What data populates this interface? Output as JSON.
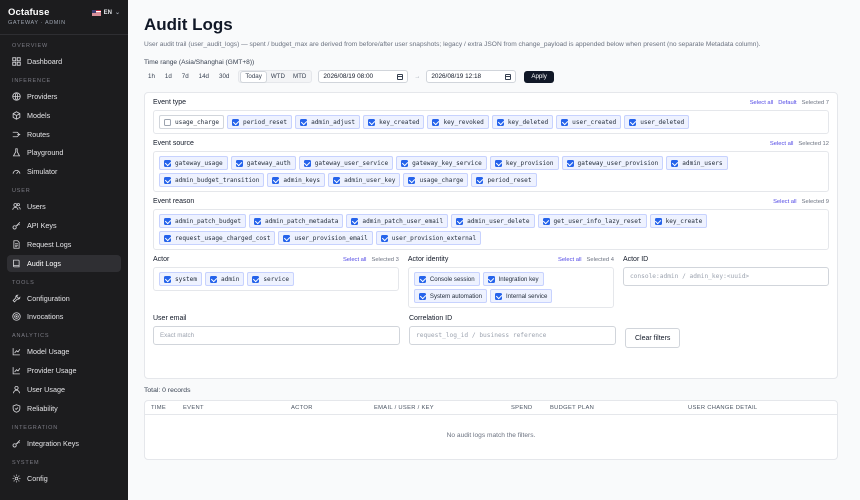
{
  "brand": {
    "name": "Octafuse",
    "subtitle": "GATEWAY · ADMIN",
    "lang": "EN"
  },
  "sidebar": {
    "sections": [
      {
        "label": "OVERVIEW",
        "items": [
          {
            "label": "Dashboard",
            "icon": "dashboard-icon"
          }
        ]
      },
      {
        "label": "INFERENCE",
        "items": [
          {
            "label": "Providers",
            "icon": "globe-icon"
          },
          {
            "label": "Models",
            "icon": "cube-icon"
          },
          {
            "label": "Routes",
            "icon": "routes-icon"
          },
          {
            "label": "Playground",
            "icon": "flask-icon"
          },
          {
            "label": "Simulator",
            "icon": "gauge-icon"
          }
        ]
      },
      {
        "label": "USER",
        "items": [
          {
            "label": "Users",
            "icon": "users-icon"
          },
          {
            "label": "API Keys",
            "icon": "key-icon"
          },
          {
            "label": "Request Logs",
            "icon": "file-icon"
          },
          {
            "label": "Audit Logs",
            "icon": "book-icon",
            "active": true
          }
        ]
      },
      {
        "label": "TOOLS",
        "items": [
          {
            "label": "Configuration",
            "icon": "wrench-icon"
          },
          {
            "label": "Invocations",
            "icon": "target-icon"
          }
        ]
      },
      {
        "label": "ANALYTICS",
        "items": [
          {
            "label": "Model Usage",
            "icon": "chart-icon"
          },
          {
            "label": "Provider Usage",
            "icon": "chart-icon"
          },
          {
            "label": "User Usage",
            "icon": "user-chart-icon"
          },
          {
            "label": "Reliability",
            "icon": "shield-icon"
          }
        ]
      },
      {
        "label": "INTEGRATION",
        "items": [
          {
            "label": "Integration Keys",
            "icon": "key-icon"
          }
        ]
      },
      {
        "label": "SYSTEM",
        "items": [
          {
            "label": "Config",
            "icon": "gear-icon"
          }
        ]
      }
    ]
  },
  "page": {
    "title": "Audit Logs",
    "subtitle": "User audit trail (user_audit_logs) — spent / budget_max are derived from before/after user snapshots; legacy / extra JSON from change_payload is appended below when present (no separate Metadata column)."
  },
  "time": {
    "label": "Time range (Asia/Shanghai (GMT+8))",
    "quick": [
      "1h",
      "1d",
      "7d",
      "14d",
      "30d"
    ],
    "periods": [
      "Today",
      "WTD",
      "MTD"
    ],
    "from": "2026/08/19 08:00",
    "to": "2026/08/19 12:18",
    "apply": "Apply"
  },
  "event_type": {
    "title": "Event type",
    "select_all": "Select all",
    "default": "Default",
    "selected": "Selected 7",
    "options": [
      {
        "label": "usage_charge",
        "checked": false
      },
      {
        "label": "period_reset",
        "checked": true
      },
      {
        "label": "admin_adjust",
        "checked": true
      },
      {
        "label": "key_created",
        "checked": true
      },
      {
        "label": "key_revoked",
        "checked": true
      },
      {
        "label": "key_deleted",
        "checked": true
      },
      {
        "label": "user_created",
        "checked": true
      },
      {
        "label": "user_deleted",
        "checked": true
      }
    ]
  },
  "event_source": {
    "title": "Event source",
    "select_all": "Select all",
    "selected": "Selected 12",
    "options": [
      {
        "label": "gateway_usage",
        "checked": true
      },
      {
        "label": "gateway_auth",
        "checked": true
      },
      {
        "label": "gateway_user_service",
        "checked": true
      },
      {
        "label": "gateway_key_service",
        "checked": true
      },
      {
        "label": "key_provision",
        "checked": true
      },
      {
        "label": "gateway_user_provision",
        "checked": true
      },
      {
        "label": "admin_users",
        "checked": true
      },
      {
        "label": "admin_budget_transition",
        "checked": true
      },
      {
        "label": "admin_keys",
        "checked": true
      },
      {
        "label": "admin_user_key",
        "checked": true
      },
      {
        "label": "usage_charge",
        "checked": true
      },
      {
        "label": "period_reset",
        "checked": true
      }
    ]
  },
  "event_reason": {
    "title": "Event reason",
    "select_all": "Select all",
    "selected": "Selected 9",
    "options": [
      {
        "label": "admin_patch_budget",
        "checked": true
      },
      {
        "label": "admin_patch_metadata",
        "checked": true
      },
      {
        "label": "admin_patch_user_email",
        "checked": true
      },
      {
        "label": "admin_user_delete",
        "checked": true
      },
      {
        "label": "get_user_info_lazy_reset",
        "checked": true
      },
      {
        "label": "key_create",
        "checked": true
      },
      {
        "label": "request_usage_charged_cost",
        "checked": true
      },
      {
        "label": "user_provision_email",
        "checked": true
      },
      {
        "label": "user_provision_external",
        "checked": true
      }
    ]
  },
  "actor": {
    "title": "Actor",
    "select_all": "Select all",
    "selected": "Selected 3",
    "options": [
      {
        "label": "system",
        "checked": true
      },
      {
        "label": "admin",
        "checked": true
      },
      {
        "label": "service",
        "checked": true
      }
    ]
  },
  "actor_identity": {
    "title": "Actor identity",
    "select_all": "Select all",
    "selected": "Selected 4",
    "options": [
      {
        "label": "Console session",
        "checked": true
      },
      {
        "label": "Integration key",
        "checked": true
      },
      {
        "label": "System automation",
        "checked": true
      },
      {
        "label": "Internal service",
        "checked": true
      }
    ]
  },
  "actor_id": {
    "label": "Actor ID",
    "placeholder": "console:admin / admin_key:<uuid>"
  },
  "user_email": {
    "label": "User email",
    "placeholder": "Exact match"
  },
  "correlation": {
    "label": "Correlation ID",
    "placeholder": "request_log_id / business reference"
  },
  "clear": "Clear filters",
  "total": "Total: 0 records",
  "table": {
    "columns": [
      "TIME",
      "EVENT",
      "ACTOR",
      "EMAIL / USER / KEY",
      "SPEND",
      "BUDGET PLAN",
      "USER CHANGE DETAIL"
    ],
    "empty": "No audit logs match the filters."
  }
}
